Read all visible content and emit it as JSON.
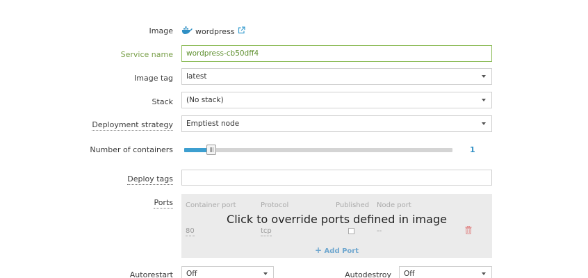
{
  "form": {
    "image_label": "Image",
    "image_name": "wordpress",
    "service_name_label": "Service name",
    "service_name_value": "wordpress-cb50dff4",
    "image_tag_label": "Image tag",
    "image_tag_value": "latest",
    "stack_label": "Stack",
    "stack_value": "(No stack)",
    "deployment_strategy_label": "Deployment strategy",
    "deployment_strategy_value": "Emptiest node",
    "containers_label": "Number of containers",
    "containers_value": "1",
    "containers_fraction": 0.1,
    "deploy_tags_label": "Deploy tags",
    "deploy_tags_value": "",
    "ports_label": "Ports",
    "autorestart_label": "Autorestart",
    "autorestart_value": "Off",
    "autodestroy_label": "Autodestroy",
    "autodestroy_value": "Off"
  },
  "ports": {
    "columns": [
      "Container port",
      "Protocol",
      "Published",
      "Node port"
    ],
    "row": {
      "container_port": "80",
      "protocol": "tcp",
      "published": false,
      "node_port": "--"
    },
    "overlay_text": "Click to override ports defined in image",
    "add_label": "Add Port"
  },
  "colors": {
    "accent": "#3d9fd0",
    "valid_green": "#8fbd5c",
    "danger": "#e06a6a"
  }
}
